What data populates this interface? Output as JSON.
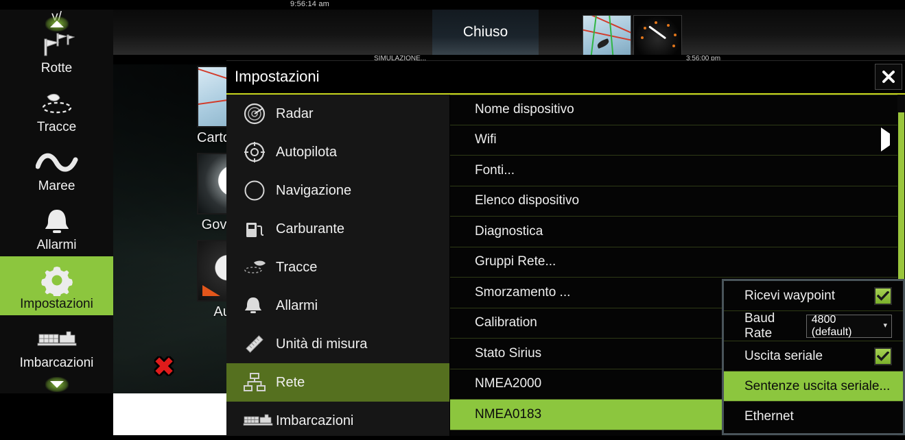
{
  "status_bar": {
    "top_time": "9:56:14 am",
    "chiuso_label": "Chiuso",
    "sim_label": "SIMULAZIONE...",
    "sim_time": "3:56:00 pm"
  },
  "background_tiles": [
    {
      "label": "Cartografia"
    },
    {
      "label": "Governo"
    },
    {
      "label": "Auto"
    }
  ],
  "left_menu": {
    "partial_top_label": "y/",
    "items": [
      {
        "label": "Rotte",
        "icon": "routes-icon",
        "selected": false
      },
      {
        "label": "Tracce",
        "icon": "tracks-icon",
        "selected": false
      },
      {
        "label": "Maree",
        "icon": "tides-icon",
        "selected": false
      },
      {
        "label": "Allarmi",
        "icon": "alarms-bell-icon",
        "selected": false
      },
      {
        "label": "Impostazioni",
        "icon": "settings-gear-icon",
        "selected": true
      },
      {
        "label": "Imbarcazioni",
        "icon": "vessels-ship-icon",
        "selected": false
      }
    ]
  },
  "dialog": {
    "title": "Impostazioni",
    "close_label": "✕",
    "categories": [
      {
        "label": "Radar",
        "icon": "radar-icon",
        "selected": false
      },
      {
        "label": "Autopilota",
        "icon": "autopilot-helm-icon",
        "selected": false
      },
      {
        "label": "Navigazione",
        "icon": "navigation-compass-icon",
        "selected": false
      },
      {
        "label": "Carburante",
        "icon": "fuel-pump-icon",
        "selected": false
      },
      {
        "label": "Tracce",
        "icon": "tracks-icon",
        "selected": false
      },
      {
        "label": "Allarmi",
        "icon": "alarms-bell-icon",
        "selected": false
      },
      {
        "label": "Unità di misura",
        "icon": "ruler-icon",
        "selected": false
      },
      {
        "label": "Rete",
        "icon": "network-icon",
        "selected": true
      },
      {
        "label": "Imbarcazioni",
        "icon": "vessels-ship-icon",
        "selected": false
      }
    ],
    "settings_rows": [
      {
        "label": "Nome dispositivo",
        "arrow": false,
        "selected": false
      },
      {
        "label": "Wifi",
        "arrow": true,
        "selected": false
      },
      {
        "label": "Fonti...",
        "arrow": false,
        "selected": false
      },
      {
        "label": "Elenco dispositivo",
        "arrow": false,
        "selected": false
      },
      {
        "label": "Diagnostica",
        "arrow": false,
        "selected": false
      },
      {
        "label": "Gruppi Rete...",
        "arrow": false,
        "selected": false
      },
      {
        "label": "Smorzamento ...",
        "arrow": false,
        "selected": false
      },
      {
        "label": "Calibration",
        "arrow": false,
        "selected": false
      },
      {
        "label": "Stato Sirius",
        "arrow": false,
        "selected": false
      },
      {
        "label": "NMEA2000",
        "arrow": false,
        "selected": false
      },
      {
        "label": "NMEA0183",
        "arrow": false,
        "selected": true
      }
    ],
    "submenu": [
      {
        "label": "Ricevi waypoint",
        "control": "checkbox",
        "checked": true,
        "selected": false
      },
      {
        "label": "Baud Rate",
        "control": "dropdown",
        "value": "4800 (default)",
        "selected": false
      },
      {
        "label": "Uscita seriale",
        "control": "checkbox",
        "checked": true,
        "selected": false
      },
      {
        "label": "Sentenze uscita seriale...",
        "control": "none",
        "selected": true
      },
      {
        "label": "Ethernet",
        "control": "none",
        "selected": false
      }
    ]
  },
  "colors": {
    "accent_green": "#8cc63e",
    "accent_green_dim": "#55701f",
    "separator_olive": "#2f3b16",
    "title_underline": "#c8d61e",
    "submenu_border": "#49545a",
    "mob_red": "#e01b1b"
  }
}
